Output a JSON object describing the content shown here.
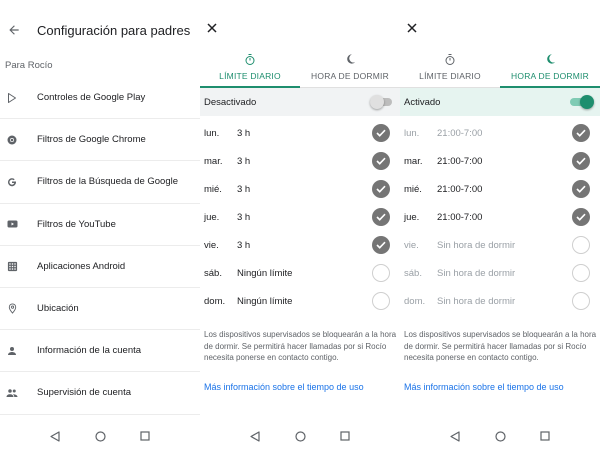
{
  "parental_settings": {
    "title": "Configuración para padres",
    "section_label": "Para Rocío",
    "items": [
      {
        "label": "Controles de Google Play",
        "icon": "google-play-icon"
      },
      {
        "label": "Filtros de Google Chrome",
        "icon": "chrome-icon"
      },
      {
        "label": "Filtros de la Búsqueda de Google",
        "icon": "google-g-icon"
      },
      {
        "label": "Filtros de YouTube",
        "icon": "youtube-icon"
      },
      {
        "label": "Aplicaciones Android",
        "icon": "apps-grid-icon"
      },
      {
        "label": "Ubicación",
        "icon": "location-pin-icon"
      },
      {
        "label": "Información de la cuenta",
        "icon": "person-icon"
      },
      {
        "label": "Supervisión de cuenta",
        "icon": "people-icon"
      }
    ]
  },
  "daily_limit_screen": {
    "tabs": [
      {
        "label": "LÍMITE DIARIO",
        "icon": "timer-icon",
        "active": true
      },
      {
        "label": "HORA DE DORMIR",
        "icon": "moon-icon",
        "active": false
      }
    ],
    "toggle_label": "Desactivado",
    "toggle_on": false,
    "days": [
      {
        "day": "lun.",
        "value": "3 h",
        "checked": true
      },
      {
        "day": "mar.",
        "value": "3 h",
        "checked": true
      },
      {
        "day": "mié.",
        "value": "3 h",
        "checked": true
      },
      {
        "day": "jue.",
        "value": "3 h",
        "checked": true
      },
      {
        "day": "vie.",
        "value": "3 h",
        "checked": true
      },
      {
        "day": "sáb.",
        "value": "Ningún límite",
        "checked": false
      },
      {
        "day": "dom.",
        "value": "Ningún límite",
        "checked": false
      }
    ],
    "info": "Los dispositivos supervisados se bloquearán a la hora de dormir. Se permitirá hacer llamadas por si Rocío necesita ponerse en contacto contigo.",
    "link": "Más información sobre el tiempo de uso"
  },
  "bedtime_screen": {
    "tabs": [
      {
        "label": "LÍMITE DIARIO",
        "icon": "timer-icon",
        "active": false
      },
      {
        "label": "HORA DE DORMIR",
        "icon": "moon-icon",
        "active": true
      }
    ],
    "toggle_label": "Activado",
    "toggle_on": true,
    "days": [
      {
        "day": "lun.",
        "value": "21:00-7:00",
        "checked": true
      },
      {
        "day": "mar.",
        "value": "21:00-7:00",
        "checked": true
      },
      {
        "day": "mié.",
        "value": "21:00-7:00",
        "checked": true
      },
      {
        "day": "jue.",
        "value": "21:00-7:00",
        "checked": true
      },
      {
        "day": "vie.",
        "value": "Sin hora de dormir",
        "checked": false
      },
      {
        "day": "sáb.",
        "value": "Sin hora de dormir",
        "checked": false
      },
      {
        "day": "dom.",
        "value": "Sin hora de dormir",
        "checked": false
      }
    ],
    "info": "Los dispositivos supervisados se bloquearán a la hora de dormir. Se permitirá hacer llamadas por si Rocío necesita ponerse en contacto contigo.",
    "link": "Más información sobre el tiempo de uso"
  },
  "colors": {
    "accent": "#1e8e6e",
    "link": "#1a73e8",
    "check_on": "#757575",
    "active_row": "#e6f4f0"
  }
}
